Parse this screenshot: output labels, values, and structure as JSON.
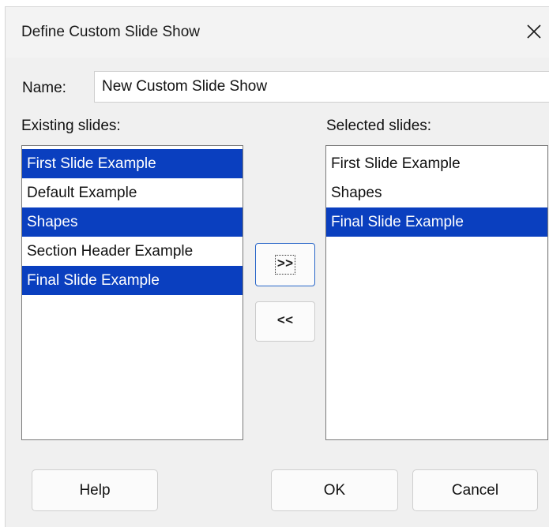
{
  "dialog": {
    "title": "Define Custom Slide Show",
    "close_icon": "close-icon"
  },
  "name_field": {
    "label": "Name:",
    "value": "New Custom Slide Show"
  },
  "existing": {
    "label": "Existing slides:",
    "items": [
      {
        "label": "First Slide Example",
        "selected": true
      },
      {
        "label": "Default Example",
        "selected": false
      },
      {
        "label": "Shapes",
        "selected": true
      },
      {
        "label": "Section Header Example",
        "selected": false
      },
      {
        "label": "Final Slide Example",
        "selected": true
      }
    ]
  },
  "selected": {
    "label": "Selected slides:",
    "items": [
      {
        "label": "First Slide Example",
        "selected": false
      },
      {
        "label": "Shapes",
        "selected": false
      },
      {
        "label": "Final Slide Example",
        "selected": true
      }
    ]
  },
  "buttons": {
    "add": ">>",
    "remove": "<<",
    "help": "Help",
    "ok": "OK",
    "cancel": "Cancel"
  },
  "colors": {
    "selection": "#0a3fbf",
    "dialog_bg": "#f0f0f0",
    "focus_border": "#2a67c9"
  }
}
